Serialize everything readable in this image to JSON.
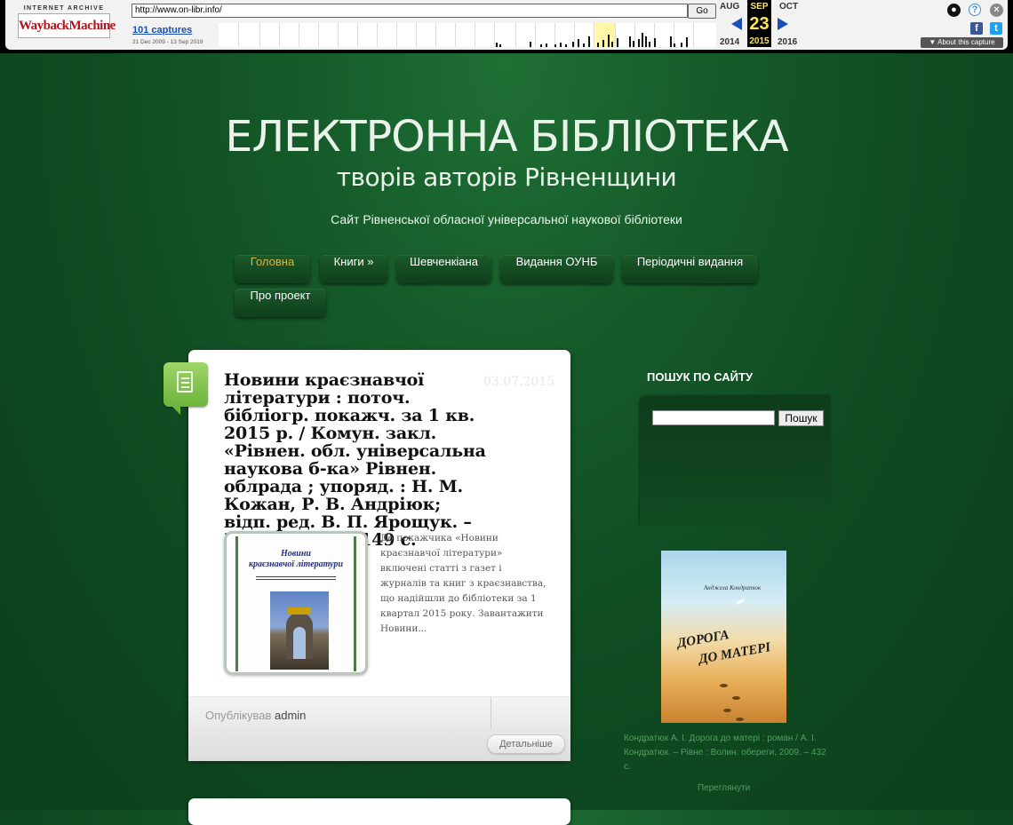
{
  "wayback": {
    "logo_top": "INTERNET ARCHIVE",
    "logo_main": "WaybackMachine",
    "url": "http://www.on-libr.info/",
    "go_label": "Go",
    "captures": "101 captures",
    "range": "21 Dec 2009 - 13 Sep 2019",
    "prev_month": "AUG",
    "cur_month": "SEP",
    "next_month": "OCT",
    "cur_day": "23",
    "prev_year": "2014",
    "cur_year": "2015",
    "next_year": "2016",
    "about": "▼ About this capture",
    "accent": "#1a4fb5",
    "highlight": "#ffe45a"
  },
  "site": {
    "title": "ЕЛЕКТРОННА БІБЛІОТЕКА",
    "subtitle": "творів авторів Рівненщини",
    "description": "Сайт Рівненської обласної універсальної наукової бібліотеки"
  },
  "nav": {
    "items": [
      {
        "label": "Головна",
        "active": true
      },
      {
        "label": "Книги »"
      },
      {
        "label": "Шевченкіана"
      },
      {
        "label": "Видання ОУНБ"
      },
      {
        "label": "Періодичні видання"
      },
      {
        "label": "Про проект"
      }
    ],
    "active_color": "#e2b13c"
  },
  "post": {
    "icon": "document-icon",
    "title": "Новини краєзнавчої літератури : поточ. бібліогр. покажч. за 1 кв. 2015 р. / Комун. закл. «Рівнен. обл. універсальна наукова б-ка» Рівнен. облрада ; упоряд. : Н. М. Кожан, Р. В. Андріюк; відп. ред. В. П. Ярощук. – Рівне, 2015. – 149 с.",
    "date": "03.07.2015",
    "cover_title_1": "Новини",
    "cover_title_2": "краєзнавчої літератури",
    "excerpt": "До покажчика «Новини краєзнавчої літератури» включені статті з газет і журналів та книг з краєзнавства, що надійшли до бібліотеки за 1 квартал 2015 року. Завантажити Новини...",
    "author_prefix": "Опублікував",
    "author": "admin",
    "more_label": "Детальніше"
  },
  "sidebar": {
    "search_title": "ПОШУК ПО САЙТУ",
    "search_value": "",
    "search_button": "Пошук",
    "book_author": "Анджела Кондратюк",
    "book_title_1": "ДОРОГА",
    "book_title_2": "ДО МАТЕРІ",
    "book_caption": "Кондратюк А. І. Дорога до матері : роман / А. І. Кондратюк. – Рівне : Волин. обереги, 2009. – 432 с.",
    "book_link": "Переглянути"
  }
}
